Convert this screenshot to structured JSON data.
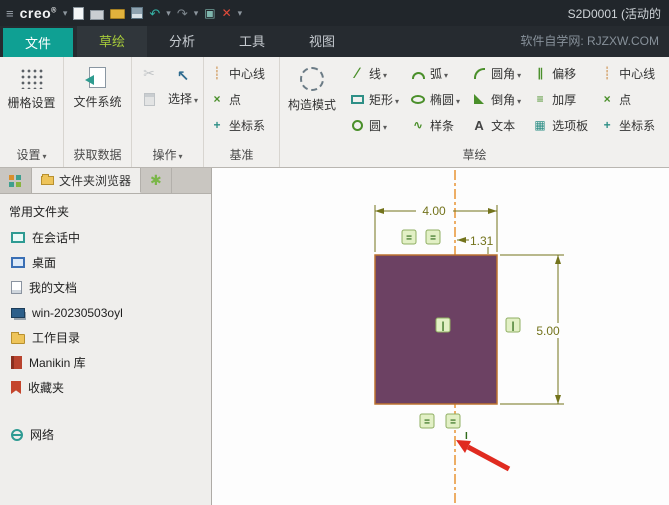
{
  "title_bar": {
    "app_name": "creo",
    "reg_mark": "®",
    "doc_title": "S2D0001 (活动的"
  },
  "tab_bar": {
    "file_tab": "文件",
    "sketch_tab": "草绘",
    "analysis_tab": "分析",
    "tools_tab": "工具",
    "view_tab": "视图",
    "watermark": "软件自学网: RJZXW.COM"
  },
  "ribbon": {
    "grid_group": {
      "button": "栅格设置",
      "footer": "设置"
    },
    "file_group": {
      "button": "文件系统",
      "footer": "获取数据"
    },
    "select_group": {
      "button": "选择",
      "footer": "操作"
    },
    "datum_group": {
      "centerline": "中心线",
      "point": "点",
      "csys": "坐标系",
      "footer": "基准"
    },
    "sketch_group": {
      "construction": "构造模式",
      "footer": "草绘",
      "line": "线",
      "rect": "矩形",
      "circle": "圆",
      "arc": "弧",
      "ellipse": "椭圆",
      "spline": "样条",
      "fillet": "圆角",
      "chamfer": "倒角",
      "text": "文本",
      "offset": "偏移",
      "thicken": "加厚",
      "palette": "选项板",
      "centerline": "中心线",
      "point": "点",
      "csys": "坐标系"
    }
  },
  "sidebar": {
    "folder_tab": "文件夹浏览器",
    "header": "常用文件夹",
    "items": [
      {
        "label": "在会话中"
      },
      {
        "label": "桌面"
      },
      {
        "label": "我的文档"
      },
      {
        "label": "win-20230503oyl"
      },
      {
        "label": "工作目录"
      },
      {
        "label": "Manikin 库"
      },
      {
        "label": "收藏夹"
      },
      {
        "label": "网络"
      }
    ]
  },
  "canvas": {
    "dim_width": "4.00",
    "dim_height": "5.00",
    "dim_offset": "1.31",
    "constraints": {
      "c1": "=",
      "c2": "=",
      "c3": "|",
      "c4": "|",
      "c5": "=",
      "c6": "=",
      "tick": "I"
    },
    "colors": {
      "rect_fill": "#6c4163",
      "rect_stroke": "#bd7330",
      "centerline": "#e58415",
      "dimension": "#73731c",
      "annotation_arrow": "#e02b20"
    }
  },
  "icons": {
    "app_menu": "≡",
    "caret": "▾",
    "undo": "↶",
    "redo": "↷",
    "window": "▣",
    "close": "✕",
    "scissors": "✂",
    "select_cursor": "↖",
    "line": "∕",
    "spline": "∿",
    "text_tool": "A",
    "offset": "∥",
    "thicken": "≡",
    "palette": "▦",
    "centerline": "┊",
    "point": "×",
    "csys": "+",
    "favorites_tab": "✱"
  }
}
